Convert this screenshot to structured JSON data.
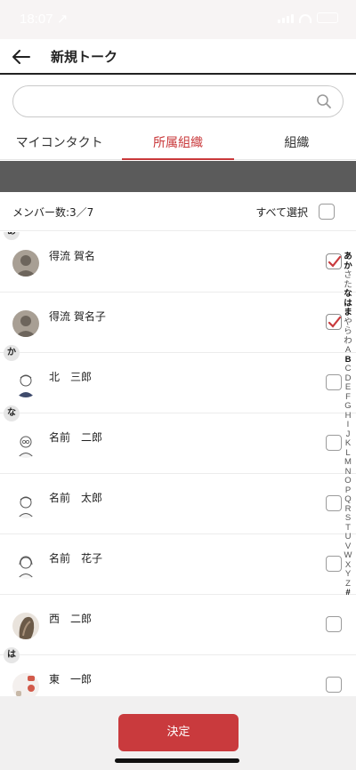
{
  "status_bar": {
    "time": "18:07 ↗"
  },
  "header": {
    "title": "新規トーク",
    "back_icon": "back-arrow-icon"
  },
  "search": {
    "value": "",
    "placeholder": ""
  },
  "tabs": [
    {
      "label": "マイコンタクト",
      "active": false
    },
    {
      "label": "所属組織",
      "active": true
    },
    {
      "label": "組織",
      "active": false
    }
  ],
  "members": {
    "count_label": "メンバー数:3／7",
    "select_all_label": "すべて選択",
    "select_all_checked": false
  },
  "contacts": [
    {
      "name": "得流 賀名",
      "checked": true,
      "avatar": "silhouette"
    },
    {
      "name": "得流 賀名子",
      "checked": true,
      "avatar": "silhouette"
    },
    {
      "name": "北　三郎",
      "checked": false,
      "avatar": "illustration"
    },
    {
      "name": "名前　二郎",
      "checked": false,
      "avatar": "illustration"
    },
    {
      "name": "名前　太郎",
      "checked": false,
      "avatar": "illustration"
    },
    {
      "name": "名前　花子",
      "checked": false,
      "avatar": "illustration"
    },
    {
      "name": "西　二郎",
      "checked": false,
      "avatar": "photo"
    },
    {
      "name": "東　一郎",
      "checked": false,
      "avatar": "photo"
    }
  ],
  "sections": [
    "あ",
    "か",
    "な",
    "は"
  ],
  "index": [
    "あ",
    "か",
    "さ",
    "た",
    "な",
    "は",
    "ま",
    "や",
    "ら",
    "わ",
    "A",
    "B",
    "C",
    "D",
    "E",
    "F",
    "G",
    "H",
    "I",
    "J",
    "K",
    "L",
    "M",
    "N",
    "O",
    "P",
    "Q",
    "R",
    "S",
    "T",
    "U",
    "V",
    "W",
    "X",
    "Y",
    "Z",
    "#"
  ],
  "footer": {
    "decide_label": "決定"
  },
  "colors": {
    "accent": "#c93a3d",
    "band": "#5b5b5b"
  }
}
